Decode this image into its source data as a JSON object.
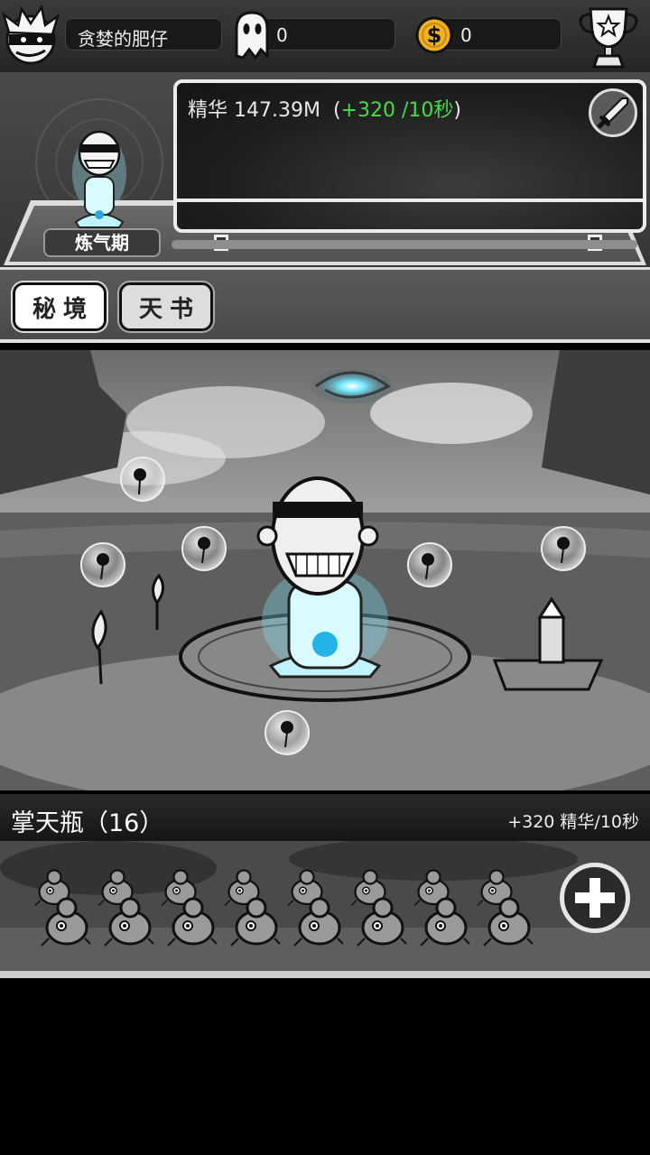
{
  "topbar": {
    "player_name": "贪婪的肥仔",
    "ghost_count": "0",
    "coin_count": "0",
    "icons": [
      "avatar-icon",
      "ghost-icon",
      "coin-icon",
      "trophy-icon"
    ]
  },
  "status": {
    "essence_label": "精华 147.39M",
    "essence_rate": "+320 /10秒",
    "rate_color": "#44dd44",
    "realm": "炼气期",
    "progress": 0
  },
  "tabs": [
    {
      "label": "秘境",
      "active": true
    },
    {
      "label": "天书",
      "active": false
    }
  ],
  "building": {
    "name": "掌天瓶（16）",
    "rate": "+320 精华/10秒",
    "count": 16
  }
}
